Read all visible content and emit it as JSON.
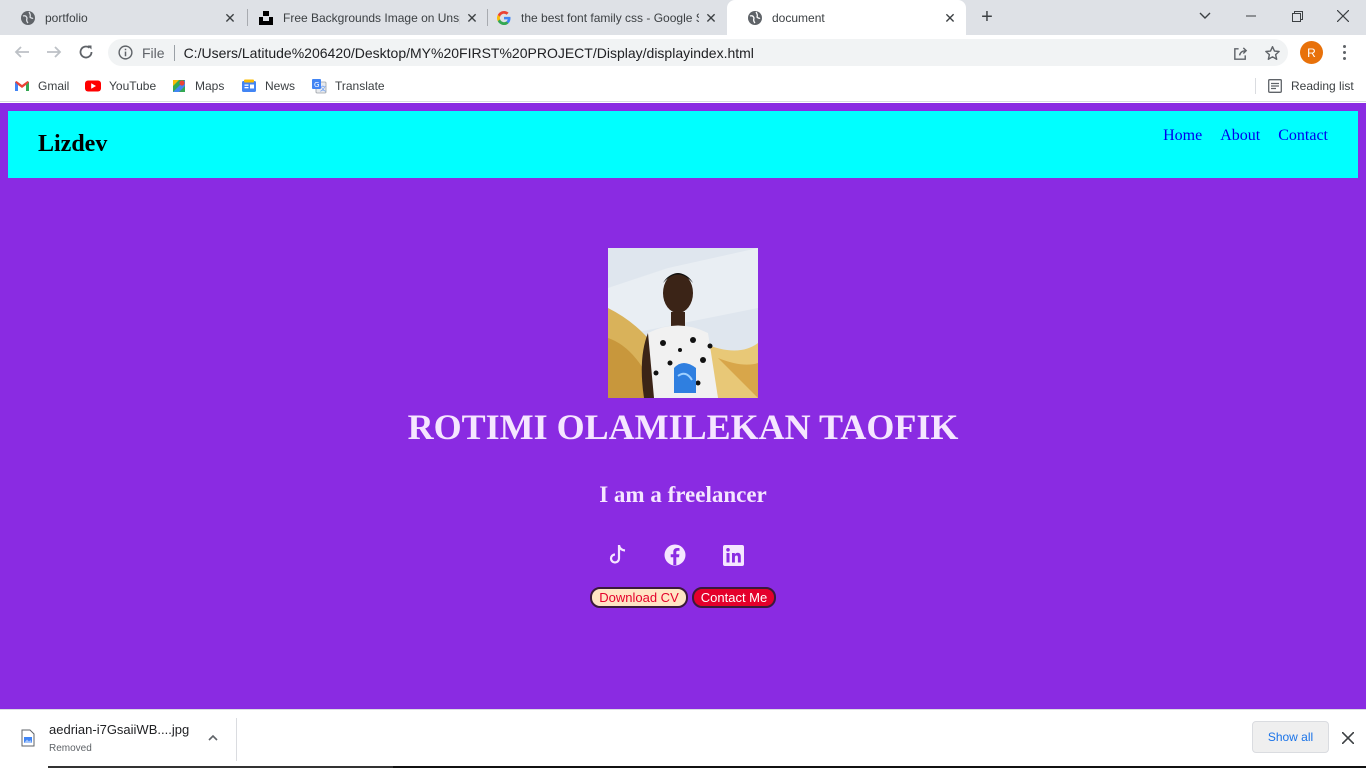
{
  "browser": {
    "tabs": [
      {
        "title": "portfolio",
        "icon": "globe-icon"
      },
      {
        "title": "Free Backgrounds Image on Unsplash",
        "icon": "unsplash-icon"
      },
      {
        "title": "the best font family css - Google Search",
        "icon": "google-icon"
      },
      {
        "title": "document",
        "icon": "globe-icon",
        "active": true
      }
    ],
    "file_label": "File",
    "url": "C:/Users/Latitude%206420/Desktop/MY%20FIRST%20PROJECT/Display/displayindex.html",
    "profile_initial": "R",
    "profile_color": "#e8710a",
    "bookmarks": [
      {
        "label": "Gmail",
        "icon": "gmail-icon"
      },
      {
        "label": "YouTube",
        "icon": "youtube-icon"
      },
      {
        "label": "Maps",
        "icon": "maps-icon"
      },
      {
        "label": "News",
        "icon": "news-icon"
      },
      {
        "label": "Translate",
        "icon": "translate-icon"
      }
    ],
    "reading_list": "Reading list"
  },
  "page": {
    "background": "#8a2be2",
    "navbar_color": "#00ffff",
    "brand": "Lizdev",
    "nav_links": [
      "Home",
      "About",
      "Contact"
    ],
    "name": "ROTIMI OLAMILEKAN TAOFIK",
    "tagline": "I am a freelancer",
    "social_icons": [
      "tiktok-icon",
      "facebook-icon",
      "linkedin-icon"
    ],
    "buttons": {
      "download_cv": "Download CV",
      "contact_me": "Contact Me"
    }
  },
  "downloads": {
    "file_name": "aedrian-i7GsaiiWB....jpg",
    "status": "Removed",
    "show_all": "Show all"
  }
}
